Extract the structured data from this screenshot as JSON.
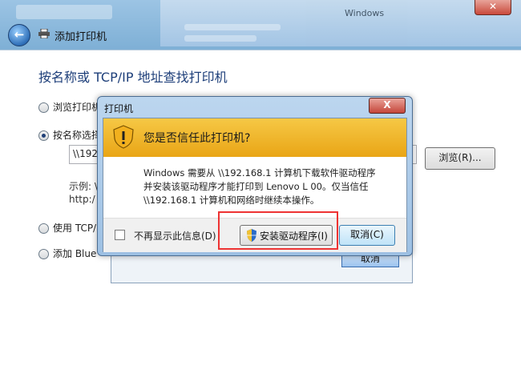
{
  "background": {
    "window_title_partial": "Windows"
  },
  "nav": {
    "title": "添加打印机"
  },
  "page": {
    "heading": "按名称或 TCP/IP 地址查找打印机",
    "options": [
      {
        "label": "浏览打印机"
      },
      {
        "label": "按名称选择"
      },
      {
        "label": "使用 TCP/IP"
      },
      {
        "label": "添加 Blue"
      }
    ],
    "path_value": "\\\\192",
    "example_line1": "示例: \\",
    "example_line2": "http:/",
    "browse_label": "浏览(R)..."
  },
  "behind_dialog": {
    "button_label": "取消"
  },
  "dialog": {
    "title": "打印机",
    "close_label": "X",
    "question": "您是否信任此打印机?",
    "message_line1": "Windows 需要从 \\\\192.168.1   计算机下载软件驱动程序",
    "message_line2": "并安装该驱动程序才能打印到 Lenovo L    00。仅当信任",
    "message_line3": "\\\\192.168.1   计算机和网络时继续本操作。",
    "checkbox_label": "不再显示此信息(D)",
    "install_label": "安装驱动程序(I)",
    "cancel_label": "取消(C)"
  }
}
